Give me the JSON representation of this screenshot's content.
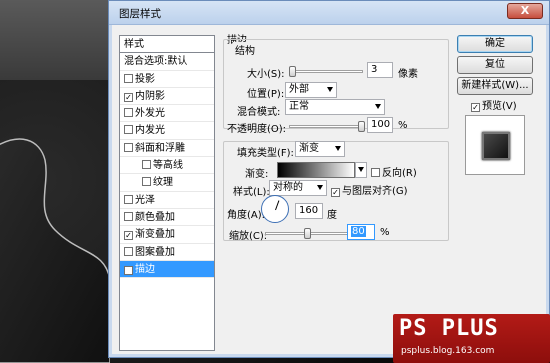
{
  "dialog": {
    "title": "图层样式",
    "close_label": "X"
  },
  "styles_list": {
    "header": "样式",
    "blend_options": "混合选项:默认",
    "items": [
      {
        "label": "投影",
        "checked": false,
        "indent": false
      },
      {
        "label": "内阴影",
        "checked": true,
        "indent": false
      },
      {
        "label": "外发光",
        "checked": false,
        "indent": false
      },
      {
        "label": "内发光",
        "checked": false,
        "indent": false
      },
      {
        "label": "斜面和浮雕",
        "checked": false,
        "indent": false
      },
      {
        "label": "等高线",
        "checked": false,
        "indent": true
      },
      {
        "label": "纹理",
        "checked": false,
        "indent": true
      },
      {
        "label": "光泽",
        "checked": false,
        "indent": false
      },
      {
        "label": "颜色叠加",
        "checked": false,
        "indent": false
      },
      {
        "label": "渐变叠加",
        "checked": true,
        "indent": false
      },
      {
        "label": "图案叠加",
        "checked": false,
        "indent": false
      },
      {
        "label": "描边",
        "checked": true,
        "indent": false,
        "selected": true
      }
    ]
  },
  "buttons": {
    "ok": "确定",
    "reset": "复位",
    "new_style": "新建样式(W)...",
    "preview": "预览(V)"
  },
  "stroke": {
    "section": "描边",
    "structure": "结构",
    "size_label": "大小(S):",
    "size_value": "3",
    "size_unit": "像素",
    "position_label": "位置(P):",
    "position_value": "外部",
    "blend_label": "混合模式:",
    "blend_value": "正常",
    "opacity_label": "不透明度(O):",
    "opacity_value": "100",
    "opacity_unit": "%"
  },
  "fill": {
    "type_label": "填充类型(F):",
    "type_value": "渐变",
    "gradient_label": "渐变:",
    "reverse_label": "反向(R)",
    "reverse_checked": false,
    "style_label": "样式(L):",
    "style_value": "对称的",
    "align_label": "与图层对齐(G)",
    "align_checked": true,
    "angle_label": "角度(A):",
    "angle_value": "160",
    "angle_unit": "度",
    "scale_label": "缩放(C):",
    "scale_value": "80",
    "scale_unit": "%"
  },
  "watermark": {
    "title": "PS PLUS",
    "url": "psplus.blog.163.com"
  }
}
